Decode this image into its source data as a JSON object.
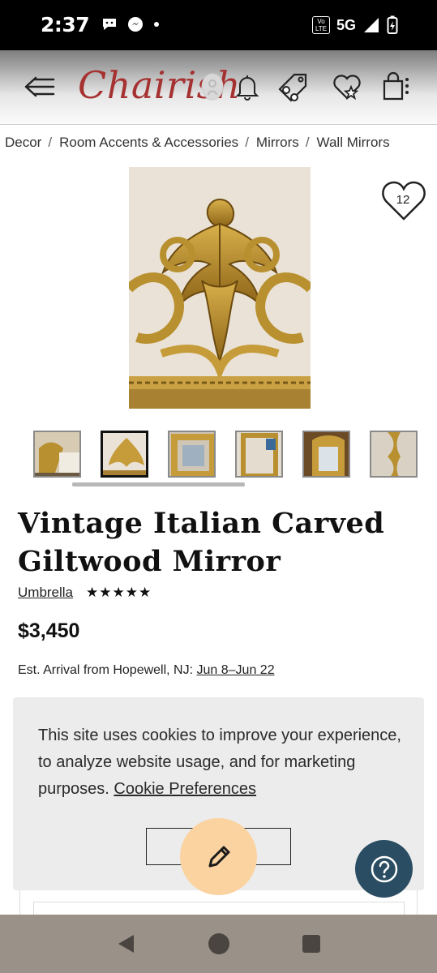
{
  "status_bar": {
    "time": "2:37",
    "network": "5G",
    "volte_label": "Vo LTE"
  },
  "header": {
    "logo_text": "Chairish",
    "icons": [
      "back-arrow-icon",
      "user-icon",
      "bell-icon",
      "tag-icon",
      "heart-star-icon",
      "cart-icon"
    ]
  },
  "breadcrumb": {
    "items": [
      "Decor",
      "Room Accents & Accessories",
      "Mirrors",
      "Wall Mirrors"
    ],
    "separator": "/"
  },
  "product": {
    "favorite_count": "12",
    "title": "Vintage Italian Carved Giltwood Mirror",
    "seller": "Umbrella",
    "rating_stars": "★★★★★",
    "price": "$3,450",
    "arrival_label": "Est. Arrival from Hopewell, NJ:",
    "arrival_dates": "Jun 8–Jun 22",
    "thumbnail_count": 6,
    "selected_thumbnail": 2
  },
  "cookie_banner": {
    "text": "This site uses cookies to improve your experience, to analyze website usage, and for marketing purposes.",
    "link_label": "Cookie Preferences"
  },
  "colors": {
    "brand": "#a63131",
    "edit_fab": "#fbd3a0",
    "help_fab": "#2a4d63",
    "nav_bar": "#9a9288"
  }
}
